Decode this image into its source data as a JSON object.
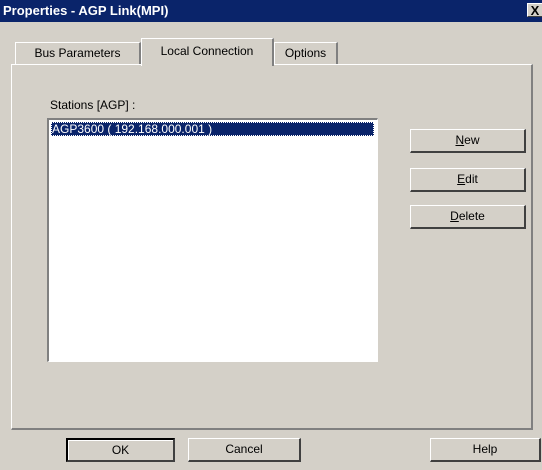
{
  "window": {
    "title": "Properties - AGP Link(MPI)",
    "close_glyph": "X"
  },
  "tabs": [
    {
      "label": "Bus Parameters",
      "active": false
    },
    {
      "label": "Local Connection",
      "active": true
    },
    {
      "label": "Options",
      "active": false
    }
  ],
  "stations": {
    "label": "Stations [AGP] :",
    "items": [
      {
        "text": "AGP3600 ( 192.168.000.001 )",
        "selected": true
      }
    ]
  },
  "side_buttons": {
    "new": {
      "mnemonic": "N",
      "rest": "ew"
    },
    "edit": {
      "mnemonic": "E",
      "rest": "dit"
    },
    "delete": {
      "mnemonic": "D",
      "rest": "elete"
    }
  },
  "footer": {
    "ok": "OK",
    "cancel": "Cancel",
    "help": "Help"
  },
  "colors": {
    "titlebar": "#0a246a",
    "face": "#d4d0c8",
    "selection": "#0a246a"
  }
}
